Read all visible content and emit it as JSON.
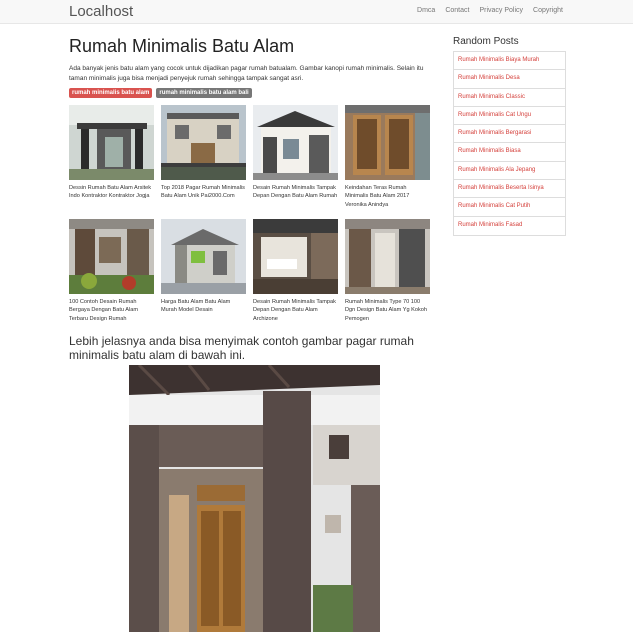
{
  "header": {
    "brand": "Localhost",
    "nav": [
      "Dmca",
      "Contact",
      "Privacy Policy",
      "Copyright"
    ]
  },
  "article": {
    "title": "Rumah Minimalis Batu Alam",
    "description": "Ada banyak jenis batu alam yang cocok untuk dijadikan pagar rumah batualam. Gambar kanopi rumah minimalis. Selain itu taman minimalis juga bisa menjadi penyejuk rumah sehingga tampak sangat asri.",
    "tags": [
      "rumah minimalis batu alam",
      "rumah minimalis batu alam bali"
    ],
    "gallery": [
      "Dessin Rumah Batu Alam Arsitek Indo Kontraktor Kontraktor Jogja",
      "Top 2018 Pagar Rumah Minimalis Batu Alam Unik Pai2000.Com",
      "Desain Rumah Minimalis Tampak Depan Dengan Batu Alam Rumah",
      "Keindahan Teras Rumah Minimalis Batu Alam 2017 Veronika Anindya",
      "100 Contoh Desain Rumah Bergaya Dengan Batu Alam Terbaru Design Rumah",
      "Harga Batu Alam Batu Alam Murah Model Desain",
      "Desain Rumah Minimalis Tampak Depan Dengan Batu Alam Archizone",
      "Rumah Minimalis Type 70 100 Dgn Design Batu Alam Yg Kokoh Pemogen"
    ],
    "subheading": "Lebih jelasnya anda bisa menyimak contoh gambar pagar rumah minimalis batu alam di bawah ini."
  },
  "sidebar": {
    "heading": "Random Posts",
    "items": [
      "Rumah Minimalis Biaya Murah",
      "Rumah Minimalis Desa",
      "Rumah Minimalis Classic",
      "Rumah Minimalis Cat Ungu",
      "Rumah Minimalis Bergarasi",
      "Rumah Minimalis Biasa",
      "Rumah Minimalis Ala Jepang",
      "Rumah Minimalis Beserta Isinya",
      "Rumah Minimalis Cat Putih",
      "Rumah Minimalis Fasad"
    ]
  }
}
